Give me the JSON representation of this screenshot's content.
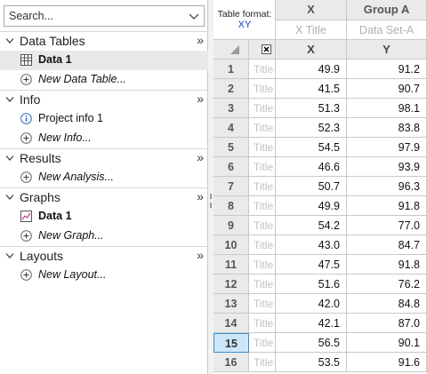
{
  "navigator": {
    "search_placeholder": "Search...",
    "sections": [
      {
        "label": "Data Tables",
        "more": "»",
        "items": [
          {
            "label": "Data 1",
            "icon": "data-table-icon",
            "bold": true,
            "selected": true
          },
          {
            "label": "New Data Table...",
            "icon": "add-circle-icon",
            "italic": true
          }
        ]
      },
      {
        "label": "Info",
        "more": "»",
        "items": [
          {
            "label": "Project info 1",
            "icon": "info-icon"
          },
          {
            "label": "New Info...",
            "icon": "add-circle-icon",
            "italic": true
          }
        ]
      },
      {
        "label": "Results",
        "more": "»",
        "items": [
          {
            "label": "New Analysis...",
            "icon": "add-circle-icon",
            "italic": true
          }
        ]
      },
      {
        "label": "Graphs",
        "more": "»",
        "items": [
          {
            "label": "Data 1",
            "icon": "graph-icon",
            "bold": true
          },
          {
            "label": "New Graph...",
            "icon": "add-circle-icon",
            "italic": true
          }
        ]
      },
      {
        "label": "Layouts",
        "more": "»",
        "items": [
          {
            "label": "New Layout...",
            "icon": "add-circle-icon",
            "italic": true
          }
        ]
      }
    ]
  },
  "sheet": {
    "table_format_label": "Table format:",
    "table_format_value": "XY",
    "col_x_header": "X",
    "col_y_header": "Group A",
    "x_title_placeholder": "X Title",
    "y_title_placeholder": "Data Set-A",
    "x_sub_header": "X",
    "y_sub_header": "Y",
    "row_title_placeholder": "Title",
    "current_row": 15,
    "rows": [
      {
        "n": "1",
        "x": "49.9",
        "y": "91.2"
      },
      {
        "n": "2",
        "x": "41.5",
        "y": "90.7"
      },
      {
        "n": "3",
        "x": "51.3",
        "y": "98.1"
      },
      {
        "n": "4",
        "x": "52.3",
        "y": "83.8"
      },
      {
        "n": "5",
        "x": "54.5",
        "y": "97.9"
      },
      {
        "n": "6",
        "x": "46.6",
        "y": "93.9"
      },
      {
        "n": "7",
        "x": "50.7",
        "y": "96.3"
      },
      {
        "n": "8",
        "x": "49.9",
        "y": "91.8"
      },
      {
        "n": "9",
        "x": "54.2",
        "y": "77.0"
      },
      {
        "n": "10",
        "x": "43.0",
        "y": "84.7"
      },
      {
        "n": "11",
        "x": "47.5",
        "y": "91.8"
      },
      {
        "n": "12",
        "x": "51.6",
        "y": "76.2"
      },
      {
        "n": "13",
        "x": "42.0",
        "y": "84.8"
      },
      {
        "n": "14",
        "x": "42.1",
        "y": "87.0"
      },
      {
        "n": "15",
        "x": "56.5",
        "y": "90.1"
      },
      {
        "n": "16",
        "x": "53.5",
        "y": "91.6"
      }
    ]
  }
}
